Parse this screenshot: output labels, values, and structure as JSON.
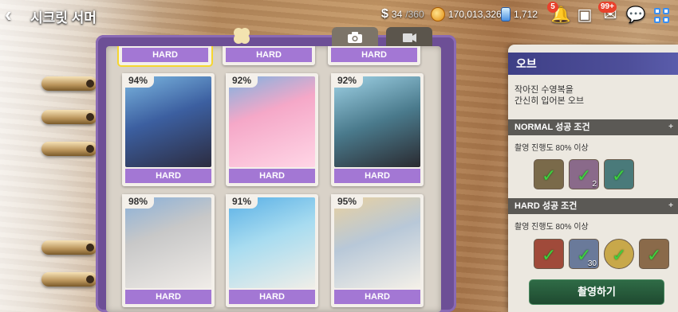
{
  "header": {
    "back_icon": "back-arrow-icon",
    "title": "시크릿 서머",
    "stamina": "34",
    "stamina_max": "/360",
    "gold": "170,013,326",
    "gems": "1,712",
    "notif_badge": "5",
    "mail_badge": "99+"
  },
  "album": {
    "tabs": [
      {
        "icon": "camera-icon"
      },
      {
        "icon": "clapper-icon"
      }
    ],
    "top_row": [
      "HARD",
      "HARD",
      "HARD"
    ],
    "cards": [
      {
        "pct": "94%",
        "label": "HARD",
        "colors": [
          "#3c5fa0",
          "#7bb6e0",
          "#2c2c40"
        ]
      },
      {
        "pct": "92%",
        "label": "HARD",
        "colors": [
          "#f5a8c8",
          "#ffd6e6",
          "#7fb2e0"
        ]
      },
      {
        "pct": "92%",
        "label": "HARD",
        "colors": [
          "#4a7a8c",
          "#2a2a30",
          "#9fd2e6"
        ]
      },
      {
        "pct": "98%",
        "label": "HARD",
        "colors": [
          "#c8c8c8",
          "#8ab0d8",
          "#f0ece8"
        ]
      },
      {
        "pct": "91%",
        "label": "HARD",
        "colors": [
          "#5ab0e6",
          "#a8dcf0",
          "#f0eee8"
        ]
      },
      {
        "pct": "95%",
        "label": "HARD",
        "colors": [
          "#b8c8d8",
          "#e8d0a0",
          "#f4f0e8"
        ]
      }
    ]
  },
  "panel": {
    "name": "오브",
    "desc_line1": "작아진 수영복을",
    "desc_line2": "간신히 입어본 오브",
    "normal_title": "NORMAL 성공 조건",
    "normal_cond": "촬영 진행도 80% 이상",
    "normal_slots": [
      {
        "color": "#7a6a4a",
        "num": ""
      },
      {
        "color": "#8a6a8a",
        "num": "2"
      },
      {
        "color": "#4a7a7a",
        "num": ""
      }
    ],
    "hard_title": "HARD 성공 조건",
    "hard_cond": "촬영 진행도 80% 이상",
    "hard_slots": [
      {
        "color": "#a04a3a",
        "num": ""
      },
      {
        "color": "#6a7a9a",
        "num": "30"
      },
      {
        "color": "#c8a84a",
        "num": ""
      },
      {
        "color": "#8a6a4a",
        "num": ""
      }
    ],
    "action_label": "촬영하기",
    "plus_glyph": "+"
  }
}
